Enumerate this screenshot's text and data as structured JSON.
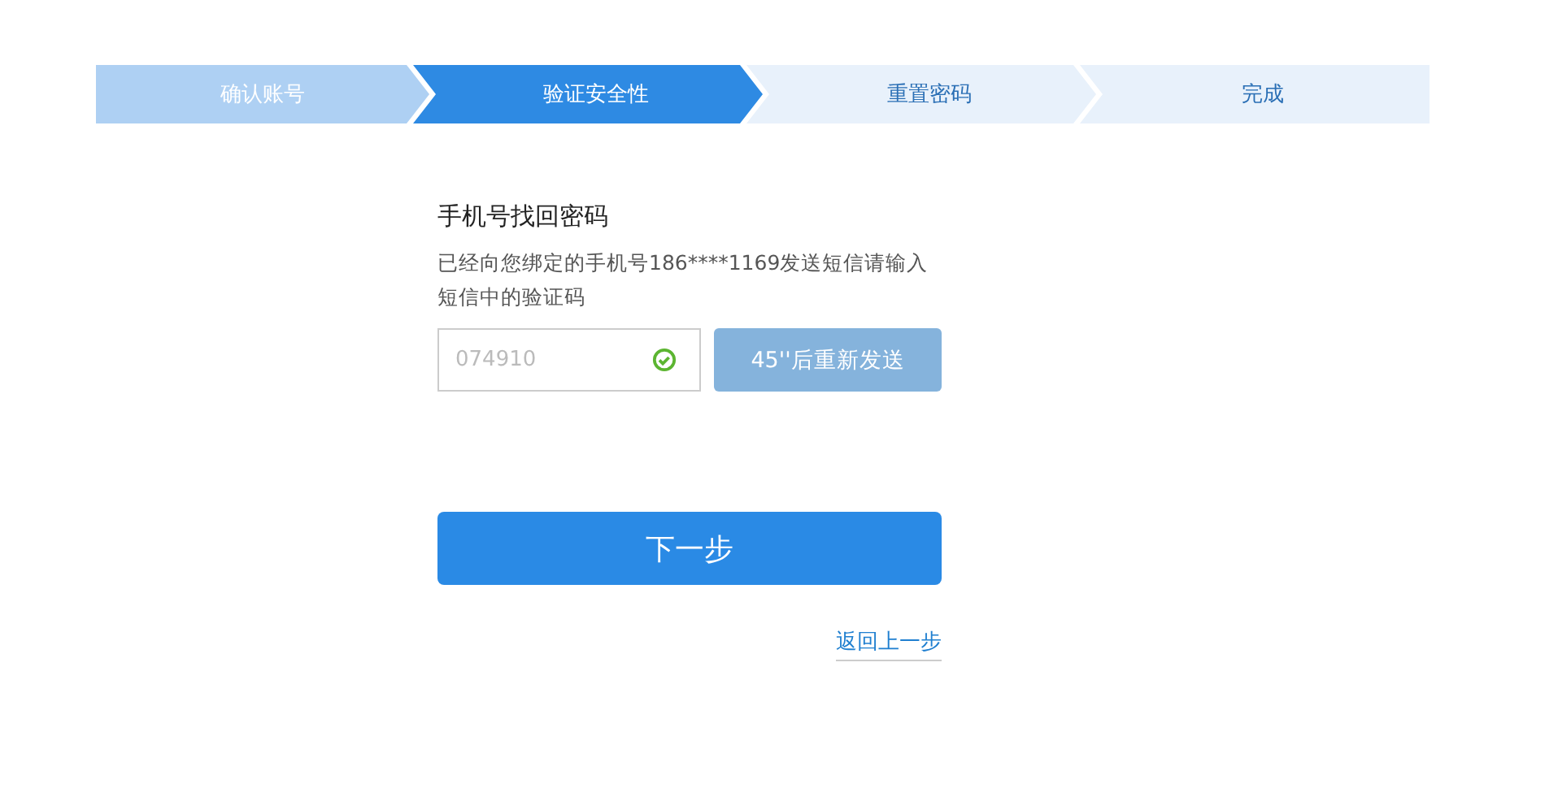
{
  "steps": [
    {
      "label": "确认账号",
      "done": true,
      "selected": false
    },
    {
      "label": "验证安全性",
      "done": false,
      "selected": true
    },
    {
      "label": "重置密码",
      "done": false,
      "selected": false
    },
    {
      "label": "完成",
      "done": false,
      "selected": false
    }
  ],
  "form": {
    "title": "手机号找回密码",
    "description": "已经向您绑定的手机号186****1169发送短信请输入短信中的验证码",
    "code_field": {
      "value": "074910",
      "valid": true
    },
    "resend_button": {
      "label": "45''后重新发送",
      "disabled": true
    },
    "next_button": {
      "label": "下一步"
    },
    "back_link": {
      "label": "返回上一步"
    }
  }
}
